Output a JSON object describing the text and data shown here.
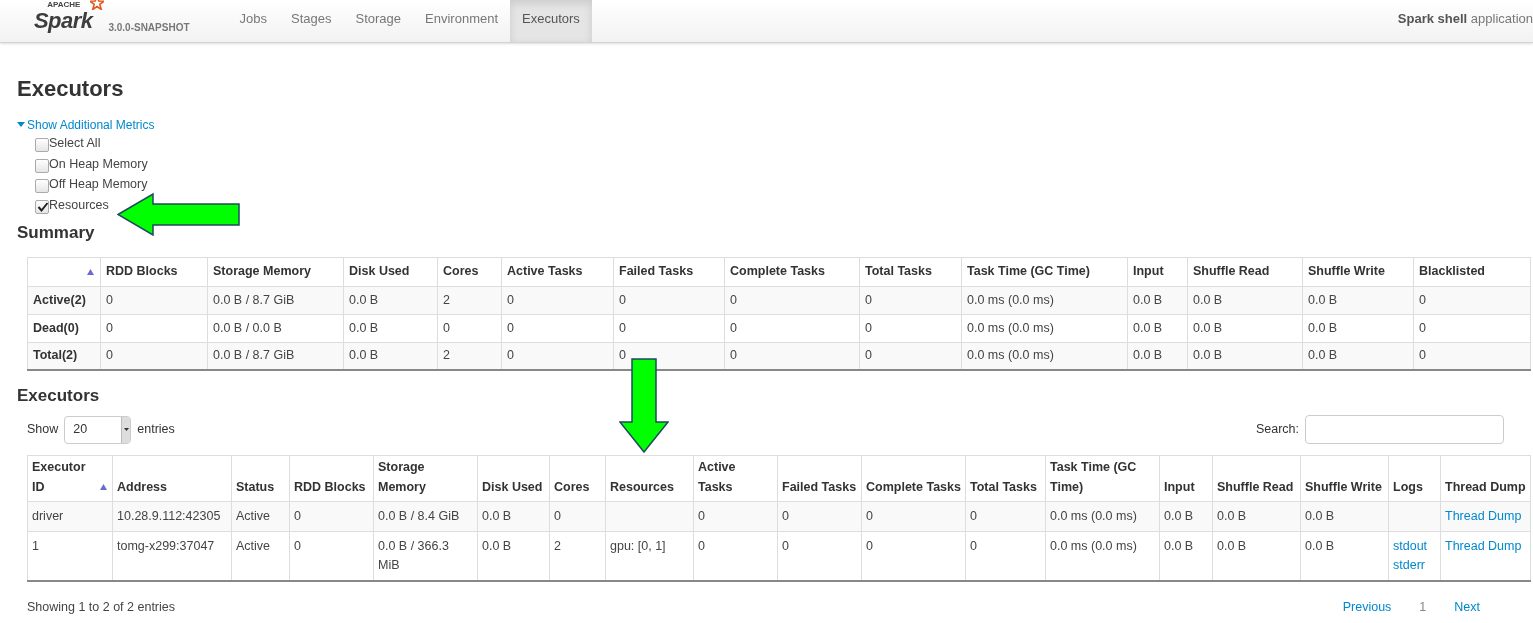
{
  "navbar": {
    "logo": {
      "small": "APACHE",
      "name": "Spark",
      "version": "3.0.0-SNAPSHOT"
    },
    "tabs": [
      {
        "label": "Jobs",
        "selected": false
      },
      {
        "label": "Stages",
        "selected": false
      },
      {
        "label": "Storage",
        "selected": false
      },
      {
        "label": "Environment",
        "selected": false
      },
      {
        "label": "Executors",
        "selected": true
      }
    ],
    "app_title": "**Spark shell** application"
  },
  "page_title": "Executors",
  "metrics_toggle": {
    "label": "Show Additional Metrics",
    "expanded": true
  },
  "metric_options": [
    {
      "label": "Select All",
      "checked": false
    },
    {
      "label": "On Heap Memory",
      "checked": false
    },
    {
      "label": "Off Heap Memory",
      "checked": false
    },
    {
      "label": "Resources",
      "checked": true
    }
  ],
  "summary": {
    "title": "Summary",
    "columns": [
      {
        "sorted": true
      },
      {
        "label": "RDD Blocks"
      },
      {
        "label": "Storage Memory"
      },
      {
        "label": "Disk Used"
      },
      {
        "label": "Cores"
      },
      {
        "label": "Active Tasks"
      },
      {
        "label": "Failed Tasks"
      },
      {
        "label": "Complete Tasks"
      },
      {
        "label": "Total Tasks"
      },
      {
        "label": "Task Time (GC Time)"
      },
      {
        "label": "Input"
      },
      {
        "label": "Shuffle Read"
      },
      {
        "label": "Shuffle Write"
      },
      {
        "label": "Blacklisted"
      }
    ],
    "rows": [
      [
        "Active(2)",
        "0",
        "0.0 B / 8.7 GiB",
        "0.0 B",
        "2",
        "0",
        "0",
        "0",
        "0",
        "0.0 ms (0.0 ms)",
        "0.0 B",
        "0.0 B",
        "0.0 B",
        "0"
      ],
      [
        "Dead(0)",
        "0",
        "0.0 B / 0.0 B",
        "0.0 B",
        "0",
        "0",
        "0",
        "0",
        "0",
        "0.0 ms (0.0 ms)",
        "0.0 B",
        "0.0 B",
        "0.0 B",
        "0"
      ],
      [
        "Total(2)",
        "0",
        "0.0 B / 8.7 GiB",
        "0.0 B",
        "2",
        "0",
        "0",
        "0",
        "0",
        "0.0 ms (0.0 ms)",
        "0.0 B",
        "0.0 B",
        "0.0 B",
        "0"
      ]
    ]
  },
  "executors": {
    "title": "Executors",
    "length_menu": {
      "before": "Show",
      "value": "20",
      "after": "entries"
    },
    "search": {
      "label": "Search:"
    },
    "columns": [
      {
        "label": "Executor ID",
        "sorted": true
      },
      {
        "label": "Address"
      },
      {
        "label": "Status"
      },
      {
        "label": "RDD Blocks"
      },
      {
        "label": "Storage Memory"
      },
      {
        "label": "Disk Used"
      },
      {
        "label": "Cores"
      },
      {
        "label": "Resources"
      },
      {
        "label": "Active Tasks"
      },
      {
        "label": "Failed Tasks"
      },
      {
        "label": "Complete Tasks"
      },
      {
        "label": "Total Tasks"
      },
      {
        "label": "Task Time (GC Time)"
      },
      {
        "label": "Input"
      },
      {
        "label": "Shuffle Read"
      },
      {
        "label": "Shuffle Write"
      },
      {
        "label": "Logs",
        "kind": "links"
      },
      {
        "label": "Thread Dump",
        "kind": "links"
      }
    ],
    "rows": [
      [
        "driver",
        "10.28.9.112:42305",
        "Active",
        "0",
        "0.0 B / 8.4 GiB",
        "0.0 B",
        "0",
        null,
        "0",
        "0",
        "0",
        "0",
        "0.0 ms (0.0 ms)",
        "0.0 B",
        "0.0 B",
        "0.0 B",
        null,
        [
          "Thread Dump"
        ]
      ],
      [
        "1",
        "tomg-x299:37047",
        "Active",
        "0",
        "0.0 B / 366.3 MiB",
        "0.0 B",
        "2",
        "gpu: [0, 1]",
        "0",
        "0",
        "0",
        "0",
        "0.0 ms (0.0 ms)",
        "0.0 B",
        "0.0 B",
        "0.0 B",
        [
          "stdout",
          "stderr"
        ],
        [
          "Thread Dump"
        ]
      ]
    ],
    "info": "Showing 1 to 2 of 2 entries",
    "pagination": [
      {
        "label": "Previous",
        "selected": false
      },
      {
        "label": "1",
        "selected": true
      },
      {
        "label": "Next",
        "selected": false
      }
    ]
  }
}
